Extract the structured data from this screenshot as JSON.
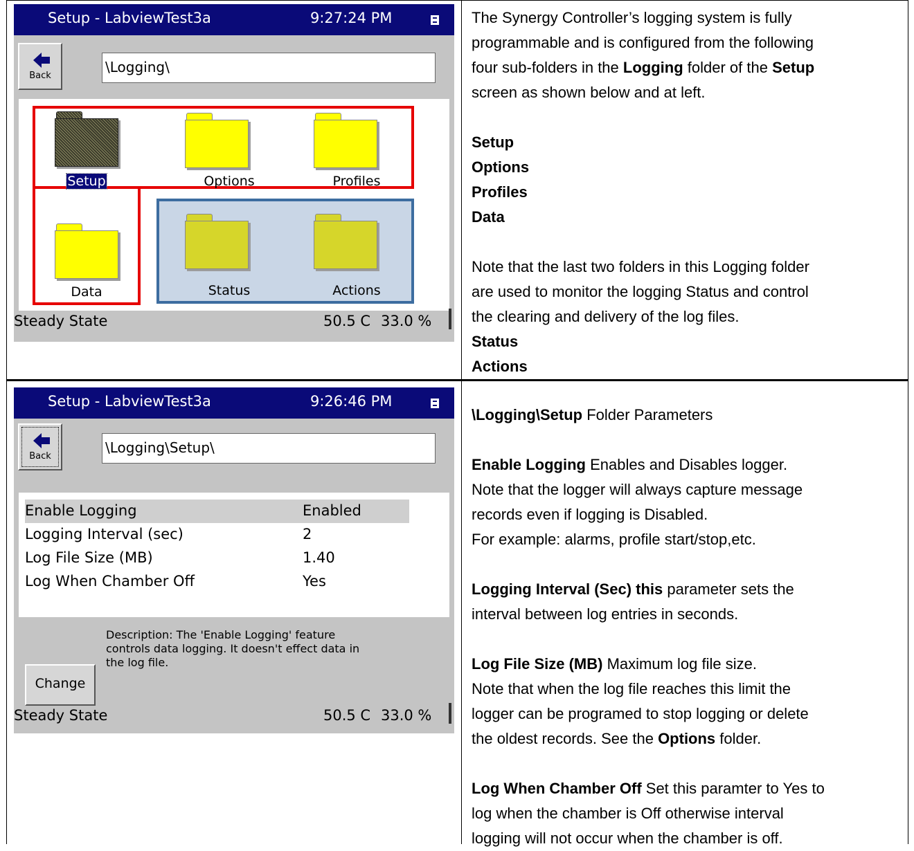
{
  "top": {
    "device": {
      "title": "Setup - LabviewTest3a",
      "time": "9:27:24 PM",
      "back_label": "Back",
      "path": "\\Logging\\",
      "folders": [
        "Setup",
        "Options",
        "Profiles",
        "Data",
        "Status",
        "Actions"
      ],
      "status": {
        "state": "Steady State",
        "temp": "50.5 C",
        "humidity": "33.0 %"
      }
    },
    "para1": [
      "The Synergy Controller’s logging system is fully",
      "programmable and is configured from the following",
      "four sub-folders in the ",
      "Logging",
      " folder of the ",
      "Setup",
      "screen as shown below and at left."
    ],
    "list1": [
      "Setup",
      "Options",
      "Profiles",
      "Data"
    ],
    "para2": [
      "Note that the last two folders in this Logging folder",
      "are used to monitor the logging Status and control",
      "the clearing and delivery of the log files."
    ],
    "list2": [
      "Status",
      "Actions"
    ]
  },
  "bottom": {
    "device": {
      "title": "Setup - LabviewTest3a",
      "time": "9:26:46 PM",
      "back_label": "Back",
      "path": "\\Logging\\Setup\\",
      "params": [
        {
          "name": "Enable Logging",
          "value": "Enabled"
        },
        {
          "name": "Logging Interval (sec)",
          "value": "2"
        },
        {
          "name": "Log File Size (MB)",
          "value": "1.40"
        },
        {
          "name": "Log When Chamber Off",
          "value": "Yes"
        }
      ],
      "description": [
        "Description:  The 'Enable Logging' feature",
        "controls data logging. It doesn't effect data in",
        "the log file."
      ],
      "change_label": "Change",
      "status": {
        "state": "Steady State",
        "temp": "50.5 C",
        "humidity": "33.0 %"
      }
    },
    "heading_bold": "\\Logging\\Setup",
    "heading_rest": " Folder Parameters",
    "enable": {
      "term": "Enable Logging",
      "text": " Enables and  Disables logger.",
      "lines": [
        "Note that the logger will always capture message",
        "records even if logging is Disabled.",
        "For example: alarms, profile start/stop,etc."
      ]
    },
    "interval": {
      "term": "Logging Interval (Sec) this",
      "text": " parameter sets the",
      "lines": [
        "interval between log entries in seconds."
      ]
    },
    "filesize": {
      "term": "Log File Size (MB)",
      "text": " Maximum log file size.",
      "lines": [
        "Note that when the log file reaches this limit the",
        "logger can be programed to stop logging or delete"
      ],
      "last_pre": "the oldest records.  See the ",
      "last_bold": "Options",
      "last_post": " folder."
    },
    "chamber": {
      "term": "Log When Chamber Off",
      "text": "  Set this paramter to Yes to",
      "lines": [
        "log when the chamber is Off otherwise interval",
        "logging will not occur when the chamber is off."
      ]
    }
  }
}
